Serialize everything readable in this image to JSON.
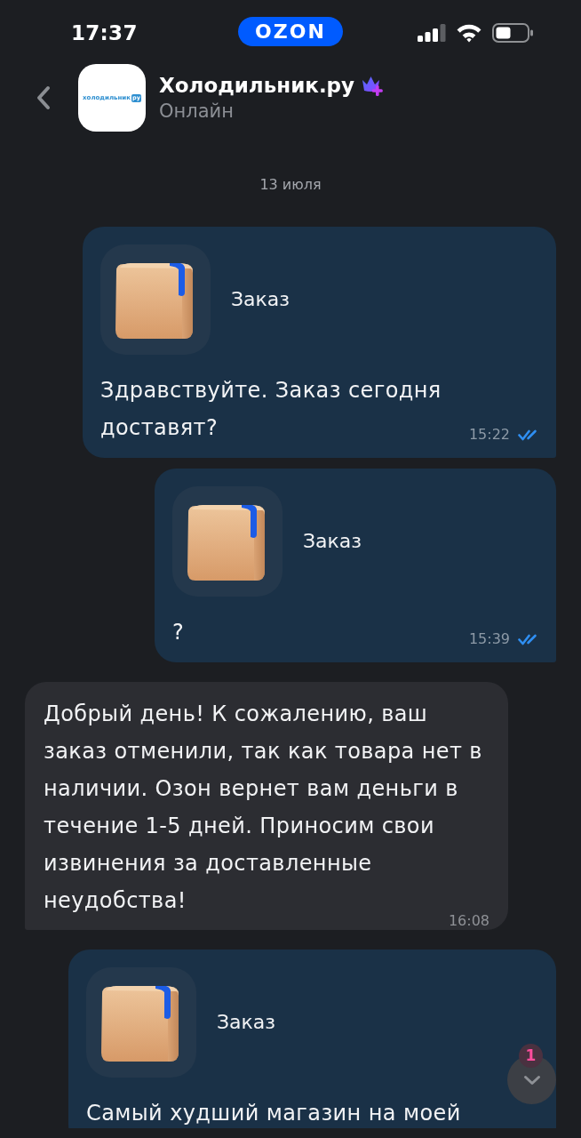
{
  "status_bar": {
    "time": "17:37",
    "app_logo": "OZON"
  },
  "chat_header": {
    "name": "Холодильник.ру",
    "status": "Онлайн",
    "premium_badge": true,
    "avatar_logo": {
      "word": "холодильник",
      "suffix": "ру"
    }
  },
  "date_separator": "13 июля",
  "messages": [
    {
      "kind": "outgoing",
      "attachment": {
        "title": "Заказ"
      },
      "text": "Здравствуйте. Заказ сегодня\nдоставят?",
      "time": "15:22",
      "read": true
    },
    {
      "kind": "outgoing",
      "attachment": {
        "title": "Заказ"
      },
      "text": "?",
      "time": "15:39",
      "read": true
    },
    {
      "kind": "incoming",
      "text": "Добрый день! К сожалению, ваш\nзаказ отменили, так как товара нет в\nналичии. Озон вернет вам деньги в\nтечение 1-5 дней. Приносим свои\nизвинения за доставленные\nнеудобства!",
      "time": "16:08"
    },
    {
      "kind": "outgoing",
      "attachment": {
        "title": "Заказ"
      },
      "text": "Самый худший магазин на моей"
    }
  ],
  "scroll_down_button": {
    "unread_count": "1"
  }
}
